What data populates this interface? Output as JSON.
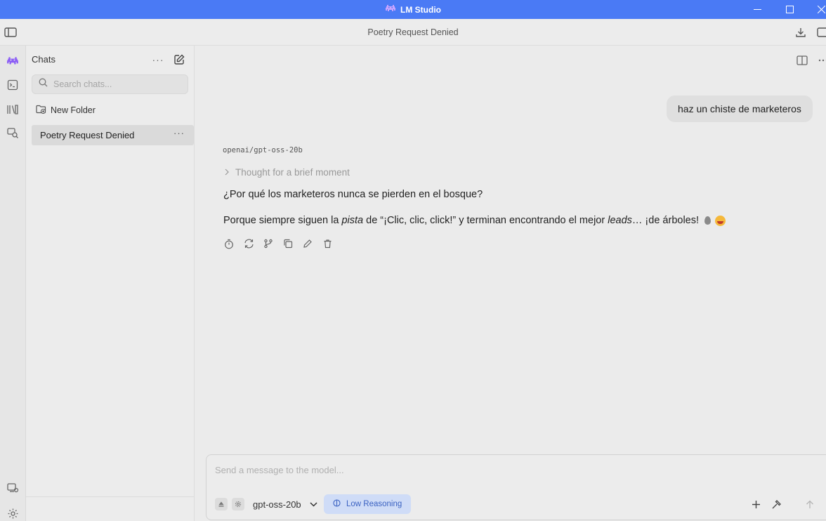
{
  "window": {
    "app_title": "LM Studio"
  },
  "header": {
    "chat_title": "Poetry Request Denied"
  },
  "sidebar": {
    "title": "Chats",
    "more_label": "···",
    "search_placeholder": "Search chats...",
    "new_folder_label": "New Folder",
    "chats": [
      {
        "label": "Poetry Request Denied",
        "more": "···"
      }
    ]
  },
  "conversation": {
    "user_message": "haz un chiste de marketeros",
    "model_name": "openai/gpt-oss-20b",
    "thought_label": "Thought for a brief moment",
    "response_line1": "¿Por qué los marketeros nunca se pierden en el bosque?",
    "response_line2": {
      "part1": "Porque siempre siguen la ",
      "italic1": "pista",
      "part2": " de “¡Clic, clic, click!” y terminan encontrando el mejor ",
      "italic2": "leads",
      "part3": "… ¡de árboles!"
    }
  },
  "composer": {
    "placeholder": "Send a message to the model...",
    "model_label": "gpt-oss-20b",
    "reasoning_label": "Low Reasoning"
  },
  "colors": {
    "titlebar": "#4a7af5",
    "reasoning_chip_bg": "#cfdcf7",
    "reasoning_chip_text": "#3b62c2",
    "accent_purple": "#8b5cf6"
  }
}
